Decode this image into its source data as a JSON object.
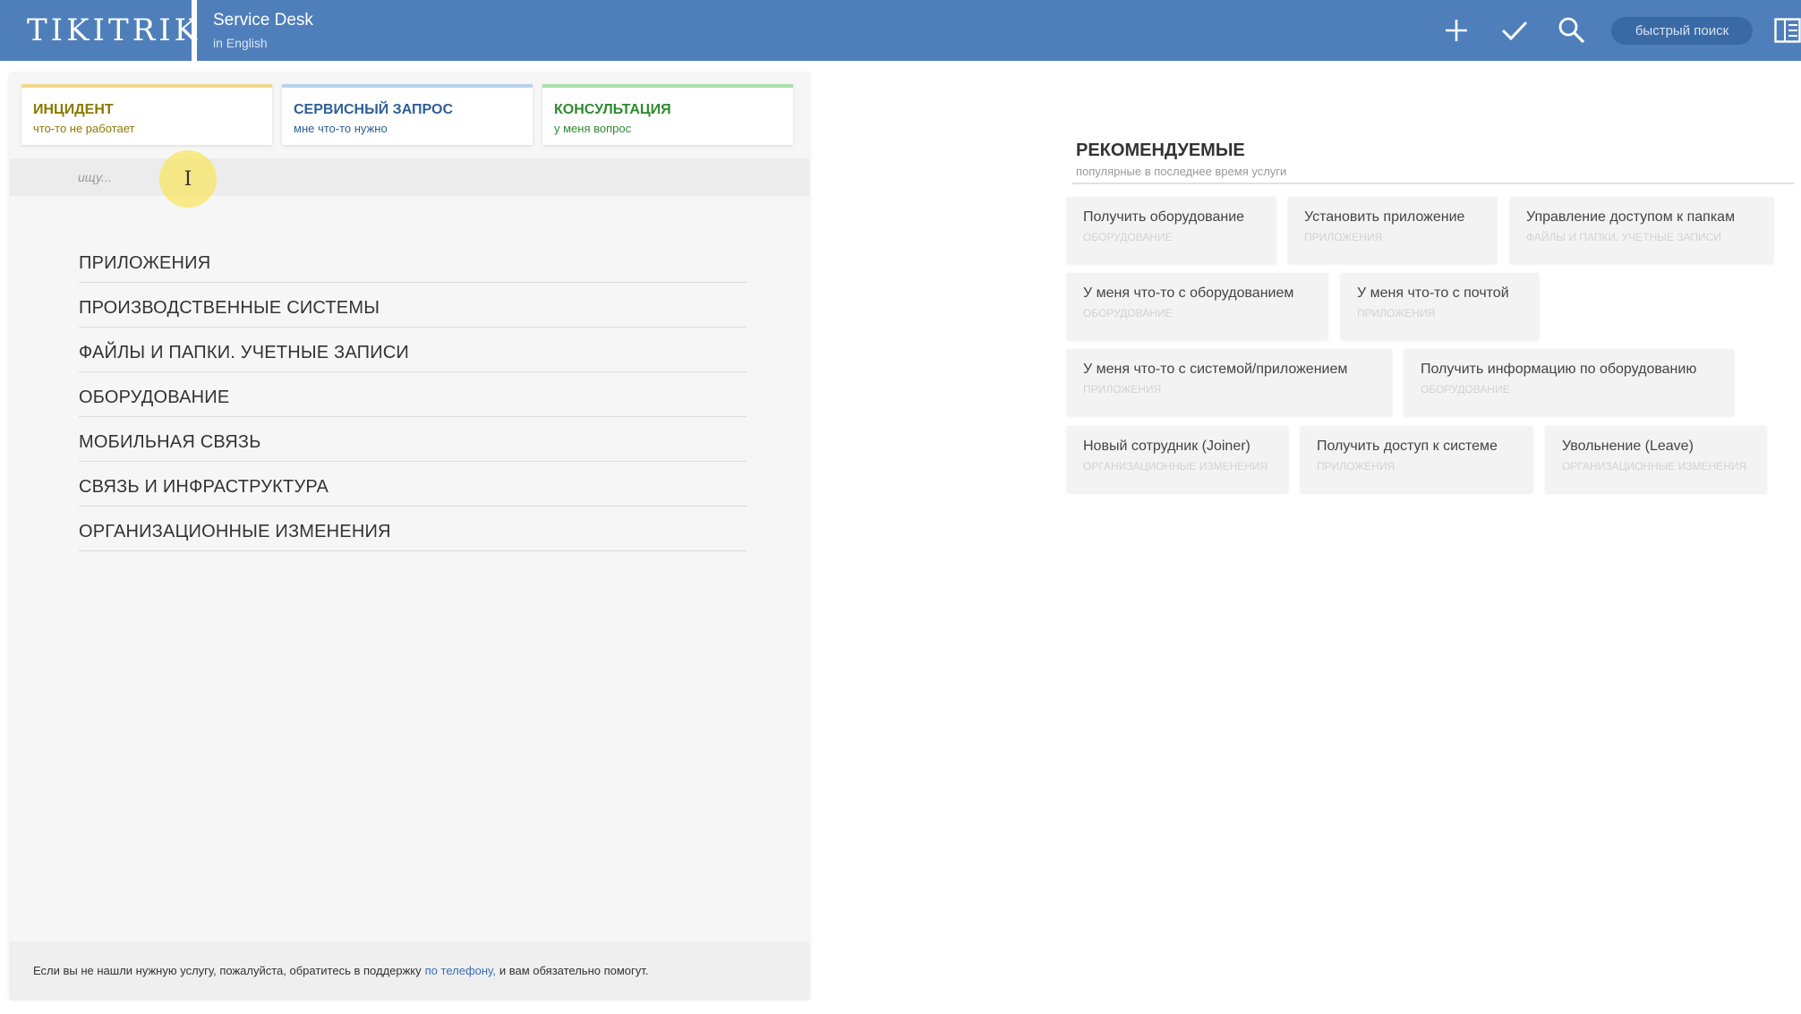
{
  "header": {
    "logo": "TIKITRIK",
    "title": "Service Desk",
    "subtitle": "in English",
    "quick_search": "быстрый поиск"
  },
  "types": [
    {
      "title": "ИНЦИДЕНТ",
      "subtitle": "что-то не работает",
      "color": "#f0d98c",
      "title_color": "#8a7a00",
      "sub_color": "#8a7a00"
    },
    {
      "title": "СЕРВИСНЫЙ ЗАПРОС",
      "subtitle": "мне что-то нужно",
      "color": "#b9d2ea",
      "title_color": "#2f5f95",
      "sub_color": "#2f5f95"
    },
    {
      "title": "КОНСУЛЬТАЦИЯ",
      "subtitle": "у меня вопрос",
      "color": "#a9dfa9",
      "title_color": "#2f8a2f",
      "sub_color": "#2f8a2f"
    }
  ],
  "search": {
    "placeholder": "ищу..."
  },
  "categories": [
    "ПРИЛОЖЕНИЯ",
    "ПРОИЗВОДСТВЕННЫЕ СИСТЕМЫ",
    "ФАЙЛЫ И ПАПКИ. УЧЕТНЫЕ ЗАПИСИ",
    "ОБОРУДОВАНИЕ",
    "МОБИЛЬНАЯ СВЯЗЬ",
    "СВЯЗЬ И ИНФРАСТРУКТУРА",
    "ОРГАНИЗАЦИОННЫЕ ИЗМЕНЕНИЯ"
  ],
  "footer": {
    "before": "Если вы не нашли нужную услугу, пожалуйста, обратитесь в поддержку",
    "link": "по телефону,",
    "after": "и вам обязательно помогут."
  },
  "recommended": {
    "title": "РЕКОМЕНДУЕМЫЕ",
    "subtitle": "популярные в последнее время услуги",
    "items": [
      {
        "name": "Получить оборудование",
        "category": "ОБОРУДОВАНИЕ"
      },
      {
        "name": "Установить приложение",
        "category": "ПРИЛОЖЕНИЯ"
      },
      {
        "name": "Управление доступом к папкам",
        "category": "ФАЙЛЫ И ПАПКИ. УЧЕТНЫЕ ЗАПИСИ"
      },
      {
        "name": "У меня что-то с оборудованием",
        "category": "ОБОРУДОВАНИЕ"
      },
      {
        "name": "У меня что-то с почтой",
        "category": "ПРИЛОЖЕНИЯ"
      },
      {
        "name": "У меня что-то с системой/приложением",
        "category": "ПРИЛОЖЕНИЯ"
      },
      {
        "name": "Получить информацию по оборудованию",
        "category": "ОБОРУДОВАНИЕ"
      },
      {
        "name": "Новый сотрудник (Joiner)",
        "category": "ОРГАНИЗАЦИОННЫЕ ИЗМЕНЕНИЯ"
      },
      {
        "name": "Получить доступ к системе",
        "category": "ПРИЛОЖЕНИЯ"
      },
      {
        "name": "Увольнение (Leave)",
        "category": "ОРГАНИЗАЦИОННЫЕ ИЗМЕНЕНИЯ"
      }
    ]
  },
  "icons": {
    "add": "plus-icon",
    "done": "checkmark-icon",
    "search": "search-icon",
    "panel": "panel-toggle-icon",
    "cursor": "text-cursor-icon"
  },
  "colors": {
    "header": "#4f7fba",
    "link": "#3a6fb5"
  }
}
